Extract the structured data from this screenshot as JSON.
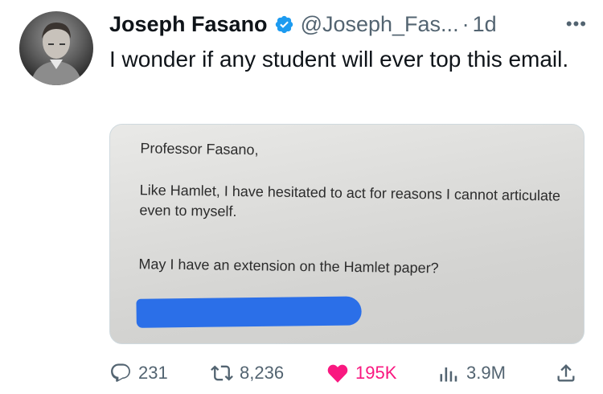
{
  "author": {
    "name": "Joseph Fasano",
    "handle": "@Joseph_Fas...",
    "separator": "·",
    "time": "1d"
  },
  "tweet": {
    "text": "I wonder if any student will ever top this email."
  },
  "media": {
    "salutation": "Professor Fasano,",
    "paragraph1": "Like Hamlet, I have hesitated to act for reasons I cannot articulate even to myself.",
    "paragraph2": "May I have an extension on the Hamlet paper?",
    "redaction_color": "#2b6fe8"
  },
  "stats": {
    "replies": "231",
    "retweets": "8,236",
    "likes": "195K",
    "views": "3.9M"
  },
  "icons": {
    "more": "more-icon",
    "verified": "verified-badge-icon",
    "reply": "reply-icon",
    "retweet": "retweet-icon",
    "like": "heart-icon",
    "views": "views-icon",
    "share": "share-icon"
  },
  "colors": {
    "verified": "#1d9bf0",
    "like": "#f91880",
    "secondary_text": "#536471"
  }
}
